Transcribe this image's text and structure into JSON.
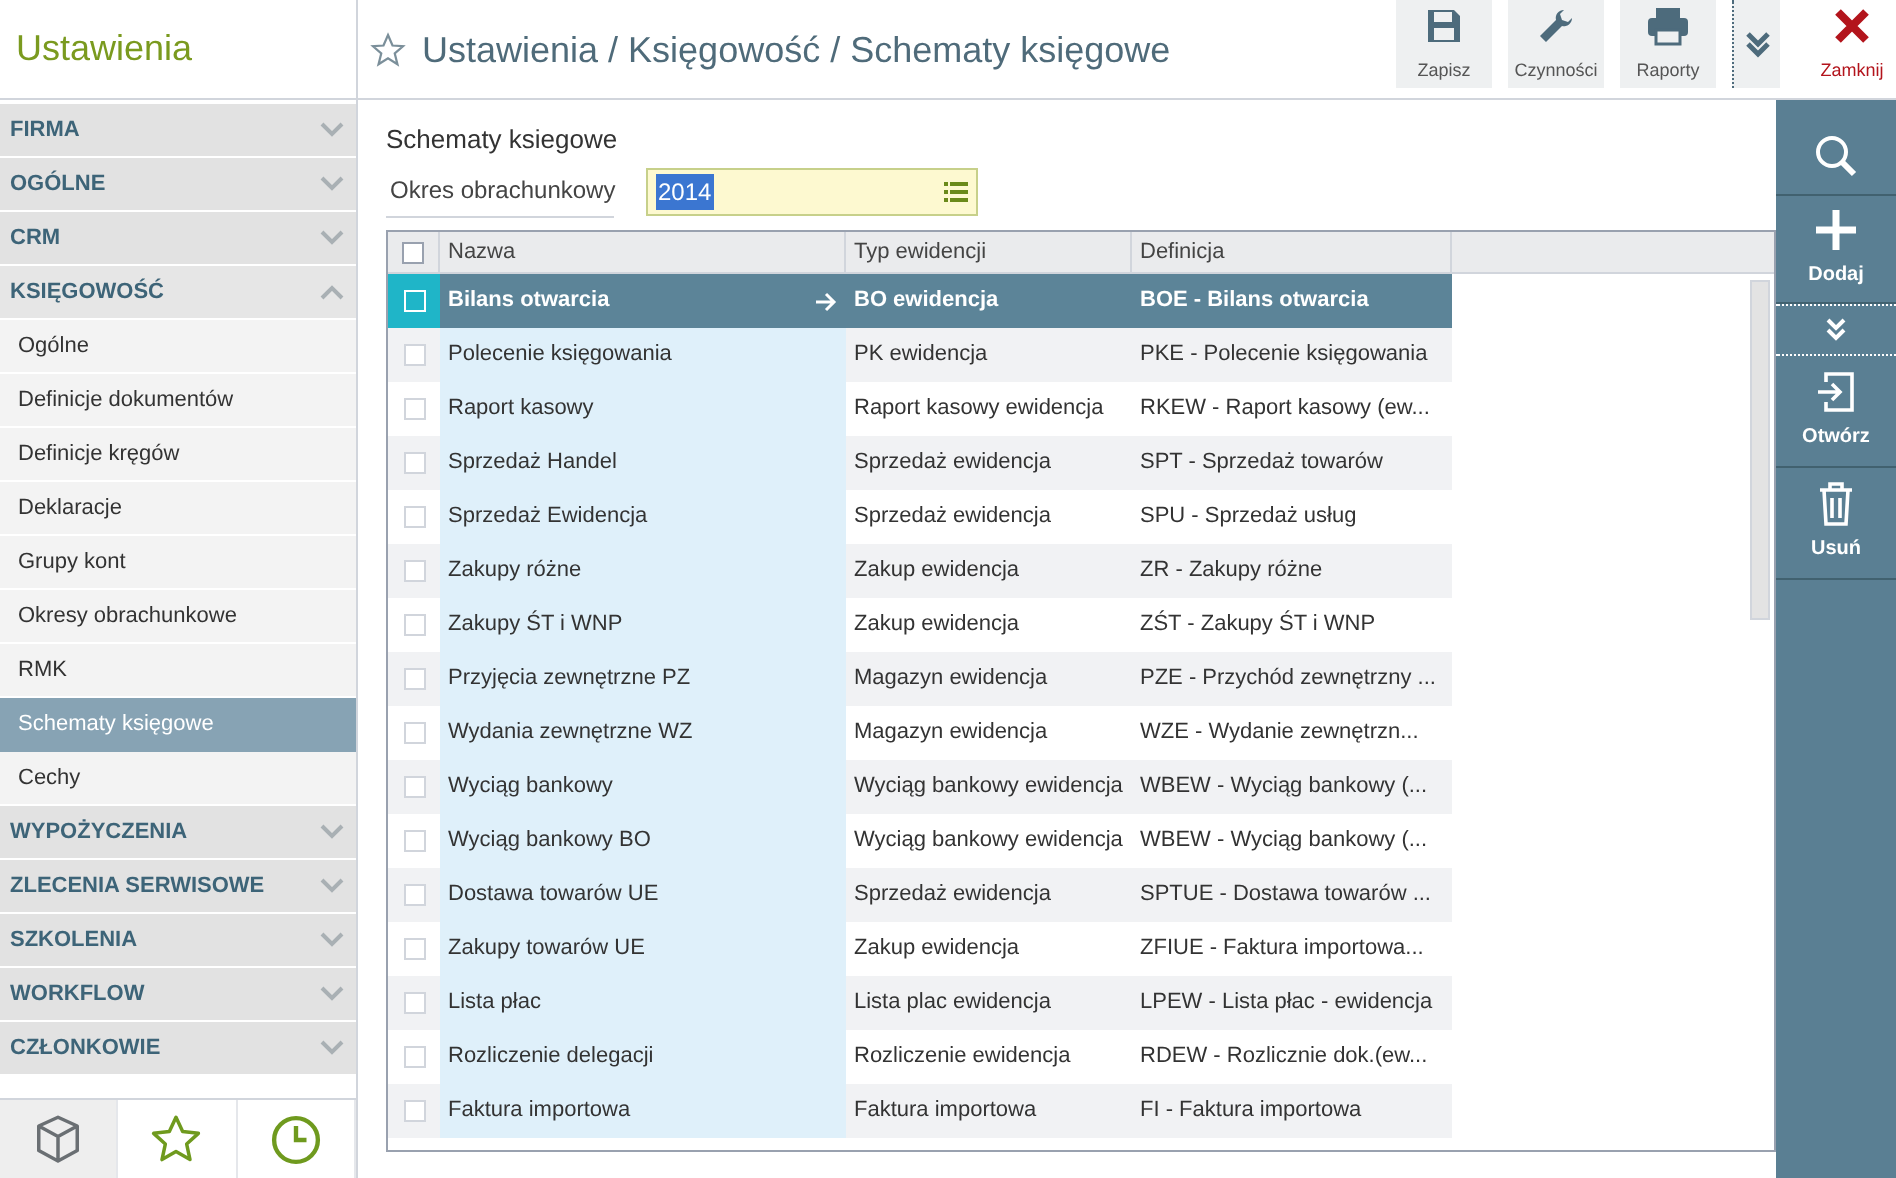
{
  "app_title": "Ustawienia",
  "breadcrumb": "Ustawienia / Księgowość / Schematy księgowe",
  "toolbar": [
    {
      "kind": "save",
      "label": "Zapisz"
    },
    {
      "kind": "actions",
      "label": "Czynności"
    },
    {
      "kind": "print",
      "label": "Raporty"
    },
    {
      "kind": "more"
    },
    {
      "kind": "close",
      "label": "Zamknij"
    }
  ],
  "sidebar": [
    {
      "label": "FIRMA",
      "expanded": false
    },
    {
      "label": "OGÓLNE",
      "expanded": false
    },
    {
      "label": "CRM",
      "expanded": false
    },
    {
      "label": "KSIĘGOWOŚĆ",
      "expanded": true,
      "children": [
        {
          "label": "Ogólne",
          "selected": false
        },
        {
          "label": "Definicje dokumentów",
          "selected": false
        },
        {
          "label": "Definicje kręgów",
          "selected": false
        },
        {
          "label": "Deklaracje",
          "selected": false
        },
        {
          "label": "Grupy kont",
          "selected": false
        },
        {
          "label": "Okresy obrachunkowe",
          "selected": false
        },
        {
          "label": "RMK",
          "selected": false
        },
        {
          "label": "Schematy księgowe",
          "selected": true
        },
        {
          "label": "Cechy",
          "selected": false
        }
      ]
    },
    {
      "label": "WYPOŻYCZENIA",
      "expanded": false
    },
    {
      "label": "ZLECENIA SERWISOWE",
      "expanded": false
    },
    {
      "label": "SZKOLENIA",
      "expanded": false
    },
    {
      "label": "WORKFLOW",
      "expanded": false
    },
    {
      "label": "CZŁONKOWIE",
      "expanded": false
    }
  ],
  "sidebar_tabs": [
    {
      "kind": "box",
      "selected": true
    },
    {
      "kind": "star",
      "selected": false
    },
    {
      "kind": "clock",
      "selected": false
    }
  ],
  "page_title": "Schematy ksiegowe",
  "period": {
    "label": "Okres obrachunkowy",
    "value": "2014"
  },
  "table": {
    "all_checked": false,
    "columns": [
      "Nazwa",
      "Typ ewidencji",
      "Definicja"
    ],
    "rows": [
      {
        "cells": [
          "Bilans otwarcia",
          "BO ewidencja",
          "BOE - Bilans otwarcia"
        ],
        "selected": true,
        "checked": false
      },
      {
        "cells": [
          "Polecenie księgowania",
          "PK ewidencja",
          "PKE - Polecenie księgowania"
        ],
        "selected": false,
        "checked": false
      },
      {
        "cells": [
          "Raport kasowy",
          "Raport kasowy ewidencja",
          "RKEW - Raport kasowy (ew..."
        ],
        "selected": false,
        "checked": false
      },
      {
        "cells": [
          "Sprzedaż Handel",
          "Sprzedaż ewidencja",
          "SPT - Sprzedaż towarów"
        ],
        "selected": false,
        "checked": false
      },
      {
        "cells": [
          "Sprzedaż Ewidencja",
          "Sprzedaż ewidencja",
          "SPU - Sprzedaż usług"
        ],
        "selected": false,
        "checked": false
      },
      {
        "cells": [
          "Zakupy różne",
          "Zakup ewidencja",
          "ZR - Zakupy różne"
        ],
        "selected": false,
        "checked": false
      },
      {
        "cells": [
          "Zakupy ŚT i WNP",
          "Zakup ewidencja",
          "ZŚT - Zakupy ŚT i WNP"
        ],
        "selected": false,
        "checked": false
      },
      {
        "cells": [
          "Przyjęcia zewnętrzne PZ",
          "Magazyn ewidencja",
          "PZE - Przychód zewnętrzny ..."
        ],
        "selected": false,
        "checked": false
      },
      {
        "cells": [
          "Wydania zewnętrzne WZ",
          "Magazyn ewidencja",
          "WZE - Wydanie zewnętrzn..."
        ],
        "selected": false,
        "checked": false
      },
      {
        "cells": [
          "Wyciąg bankowy",
          "Wyciąg bankowy ewidencja",
          "WBEW - Wyciąg bankowy (..."
        ],
        "selected": false,
        "checked": false
      },
      {
        "cells": [
          "Wyciąg bankowy BO",
          "Wyciąg bankowy ewidencja",
          "WBEW - Wyciąg bankowy (..."
        ],
        "selected": false,
        "checked": false
      },
      {
        "cells": [
          "Dostawa towarów UE",
          "Sprzedaż ewidencja",
          "SPTUE - Dostawa towarów ..."
        ],
        "selected": false,
        "checked": false
      },
      {
        "cells": [
          "Zakupy towarów UE",
          "Zakup ewidencja",
          "ZFIUE - Faktura importowa..."
        ],
        "selected": false,
        "checked": false
      },
      {
        "cells": [
          "Lista płac",
          "Lista plac ewidencja",
          "LPEW - Lista płac - ewidencja"
        ],
        "selected": false,
        "checked": false
      },
      {
        "cells": [
          "Rozliczenie delegacji",
          "Rozliczenie ewidencja",
          "RDEW - Rozlicznie dok.(ew..."
        ],
        "selected": false,
        "checked": false
      },
      {
        "cells": [
          "Faktura importowa",
          "Faktura importowa",
          "FI - Faktura importowa"
        ],
        "selected": false,
        "checked": false
      }
    ]
  },
  "actions": [
    {
      "kind": "search"
    },
    {
      "kind": "add",
      "label": "Dodaj"
    },
    {
      "kind": "expand"
    },
    {
      "kind": "open",
      "label": "Otwórz"
    },
    {
      "kind": "delete",
      "label": "Usuń"
    }
  ]
}
